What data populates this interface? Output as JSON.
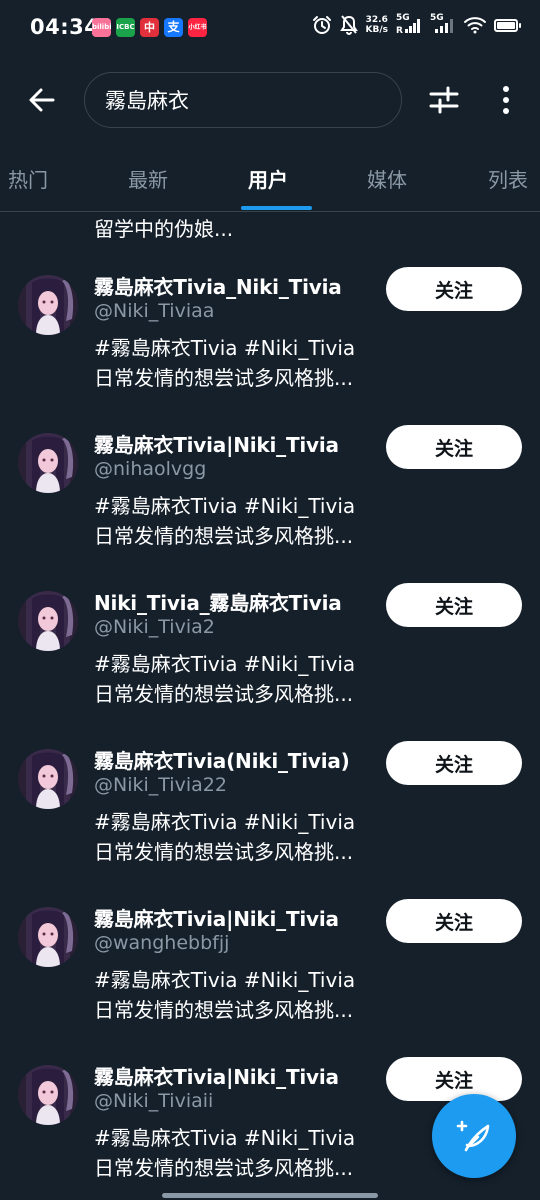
{
  "status_bar": {
    "time": "04:34",
    "net_speed_value": "32.6",
    "net_speed_unit": "KB/s",
    "sim1_label": "5G",
    "sim1_sub": "R",
    "sim2_label": "5G",
    "app_icons": [
      {
        "name": "bilibili",
        "text": "bilibili",
        "color": "#fb7299"
      },
      {
        "name": "bank",
        "text": "ICBC",
        "color": "#1aa34a"
      },
      {
        "name": "bank-of-china",
        "text": "中",
        "color": "#e0303b"
      },
      {
        "name": "alipay",
        "text": "支",
        "color": "#1677ff"
      },
      {
        "name": "xiaohongshu",
        "text": "小红书",
        "color": "#ff2442"
      }
    ]
  },
  "header": {
    "search_query": "霧島麻衣"
  },
  "tabs": [
    {
      "label": "热门",
      "active": false
    },
    {
      "label": "最新",
      "active": false
    },
    {
      "label": "用户",
      "active": true
    },
    {
      "label": "媒体",
      "active": false
    },
    {
      "label": "列表",
      "active": false
    }
  ],
  "prev_item_bio": "留学中的伪娘...",
  "follow_label": "关注",
  "users": [
    {
      "name": "霧島麻衣Tivia_Niki_Tivia",
      "handle": "@Niki_Tiviaa",
      "bio_line1": "#霧島麻衣Tivia #Niki_Tivia",
      "bio_line2": "日常发情的想尝试多风格挑..."
    },
    {
      "name": "霧島麻衣Tivia|Niki_Tivia",
      "handle": "@nihaolvgg",
      "bio_line1": "#霧島麻衣Tivia #Niki_Tivia",
      "bio_line2": "日常发情的想尝试多风格挑..."
    },
    {
      "name": "Niki_Tivia_霧島麻衣Tivia",
      "handle": "@Niki_Tivia2",
      "bio_line1": "#霧島麻衣Tivia #Niki_Tivia",
      "bio_line2": "日常发情的想尝试多风格挑..."
    },
    {
      "name": "霧島麻衣Tivia(Niki_Tivia)",
      "handle": "@Niki_Tivia22",
      "bio_line1": "#霧島麻衣Tivia #Niki_Tivia",
      "bio_line2": "日常发情的想尝试多风格挑..."
    },
    {
      "name": "霧島麻衣Tivia|Niki_Tivia",
      "handle": "@wanghebbfjj",
      "bio_line1": "#霧島麻衣Tivia #Niki_Tivia",
      "bio_line2": "日常发情的想尝试多风格挑..."
    },
    {
      "name": "霧島麻衣Tivia|Niki_Tivia",
      "handle": "@Niki_Tiviaii",
      "bio_line1": "#霧島麻衣Tivia #Niki_Tivia",
      "bio_line2": "日常发情的想尝试多风格挑..."
    }
  ],
  "colors": {
    "background": "#15202b",
    "accent": "#1d9bf0",
    "secondary_text": "#8b98a5",
    "divider": "#38444d"
  }
}
